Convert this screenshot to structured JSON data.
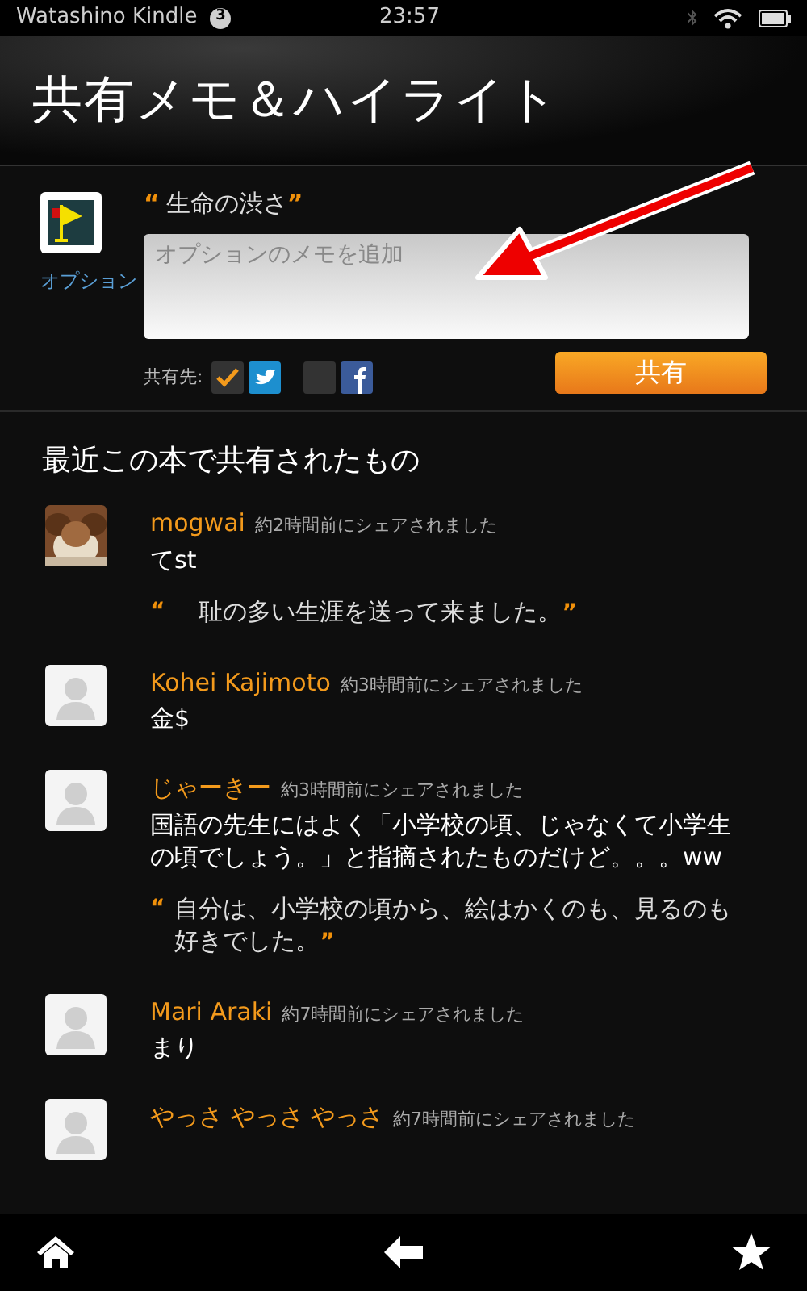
{
  "status_bar": {
    "device": "Watashino Kindle",
    "notifications": "3",
    "time": "23:57"
  },
  "header": {
    "title": "共有メモ＆ハイライト"
  },
  "book": {
    "options_link": "オプション",
    "highlight": "生命の渋さ",
    "open_quote": "“",
    "close_quote": "”"
  },
  "note_field": {
    "placeholder": "オプションのメモを追加"
  },
  "share_to": {
    "label": "共有先:",
    "targets": [
      {
        "kind": "twitter",
        "checked": true
      },
      {
        "kind": "facebook",
        "checked": false
      }
    ],
    "button": "共有"
  },
  "recent": {
    "heading": "最近この本で共有されたもの",
    "items": [
      {
        "photo": true,
        "user": "mogwai",
        "time": "約2時間前にシェアされました",
        "comment": "てst",
        "quote": {
          "open": "“",
          "text": "　耻の多い生涯を送って来ました。",
          "close": "”"
        }
      },
      {
        "photo": false,
        "user": "Kohei Kajimoto",
        "time": "約3時間前にシェアされました",
        "comment": "金$"
      },
      {
        "photo": false,
        "user": "じゃーきー",
        "time": "約3時間前にシェアされました",
        "comment": "国語の先生にはよく「小学校の頃、じゃなくて小学生の頃でしょう。」と指摘されたものだけど。。。ww",
        "quote": {
          "open": "“",
          "text": "自分は、小学校の頃から、絵はかくのも、見るのも好きでした。",
          "close": "”"
        }
      },
      {
        "photo": false,
        "user": "Mari Araki",
        "time": "約7時間前にシェアされました",
        "comment": "まり"
      },
      {
        "photo": false,
        "user": "やっさ やっさ やっさ",
        "time": "約7時間前にシェアされました"
      }
    ]
  },
  "annotation": {
    "kind": "arrow"
  }
}
